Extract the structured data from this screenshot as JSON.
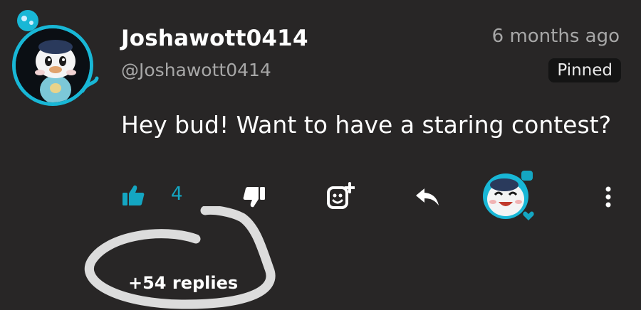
{
  "comment": {
    "username": "Joshawott0414",
    "handle": "@Joshawott0414",
    "timestamp": "6 months ago",
    "pinned_label": "Pinned",
    "text": "Hey bud! Want to have a staring contest?"
  },
  "actions": {
    "like_count": "4",
    "like_icon": "thumbs-up-icon",
    "dislike_icon": "thumbs-down-icon",
    "sticker_icon": "sticker-add-icon",
    "reply_icon": "reply-arrow-icon",
    "heart_icon": "creator-heart-icon",
    "more_icon": "more-vertical-icon"
  },
  "replies": {
    "label": "+54 replies"
  },
  "colors": {
    "background": "#282626",
    "accent": "#14a6c2",
    "secondary_text": "#a7a7a7"
  }
}
